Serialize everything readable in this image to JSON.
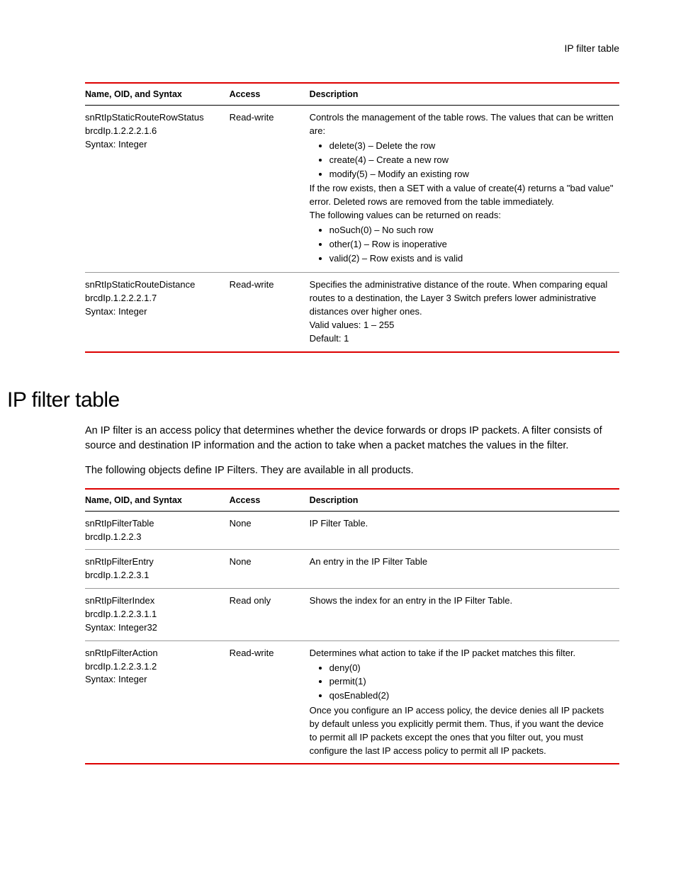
{
  "pageHeader": "IP filter table",
  "table1": {
    "headers": {
      "c1": "Name, OID, and Syntax",
      "c2": "Access",
      "c3": "Description"
    },
    "rows": [
      {
        "name1": "snRtIpStaticRouteRowStatus",
        "name2": "brcdIp.1.2.2.2.1.6",
        "name3": "Syntax: Integer",
        "access": "Read-write",
        "descPre": "Controls the management of the table rows. The values that can be written are:",
        "bullets1": [
          "delete(3) – Delete the row",
          "create(4) – Create a new row",
          "modify(5) – Modify an existing row"
        ],
        "descMid": "If the row exists, then a SET with a value of create(4) returns a \"bad value\" error. Deleted rows are removed from the table immediately.",
        "descMid2": "The following values can be returned on reads:",
        "bullets2": [
          "noSuch(0) – No such row",
          "other(1) – Row is inoperative",
          "valid(2) – Row exists and is valid"
        ]
      },
      {
        "name1": "snRtIpStaticRouteDistance",
        "name2": "brcdIp.1.2.2.2.1.7",
        "name3": "Syntax: Integer",
        "access": "Read-write",
        "descPre": "Specifies the administrative distance of the route. When comparing equal routes to a destination, the Layer 3 Switch prefers lower administrative distances over higher ones.",
        "descMid": "Valid values: 1 – 255",
        "descMid2": "Default: 1"
      }
    ]
  },
  "sectionHeading": "IP filter table",
  "body1": "An IP filter is an access policy that determines whether the device forwards or drops IP packets. A filter consists of source and destination IP information and the action to take when a packet matches the values in the filter.",
  "body2": "The following objects define IP Filters. They are available in all products.",
  "table2": {
    "headers": {
      "c1": "Name, OID, and Syntax",
      "c2": "Access",
      "c3": "Description"
    },
    "rows": [
      {
        "name1": "snRtIpFilterTable",
        "name2": "brcdIp.1.2.2.3",
        "name3": "",
        "access": "None",
        "descPre": "IP Filter Table."
      },
      {
        "name1": "snRtIpFilterEntry",
        "name2": "brcdIp.1.2.2.3.1",
        "name3": "",
        "access": "None",
        "descPre": "An entry in the IP Filter Table"
      },
      {
        "name1": "snRtIpFilterIndex",
        "name2": "brcdIp.1.2.2.3.1.1",
        "name3": "Syntax: Integer32",
        "access": "Read only",
        "descPre": "Shows the index for an entry in the IP Filter Table."
      },
      {
        "name1": "snRtIpFilterAction",
        "name2": "brcdIp.1.2.2.3.1.2",
        "name3": "Syntax: Integer",
        "access": "Read-write",
        "descPre": "Determines what action to take if the IP packet matches this filter.",
        "bullets1": [
          "deny(0)",
          "permit(1)",
          "qosEnabled(2)"
        ],
        "descMid": "Once you configure an IP access policy, the device denies all IP packets by default unless you explicitly permit them. Thus, if you want the device to permit all IP packets except the ones that you filter out, you must configure the last IP access policy to permit all IP packets."
      }
    ]
  }
}
